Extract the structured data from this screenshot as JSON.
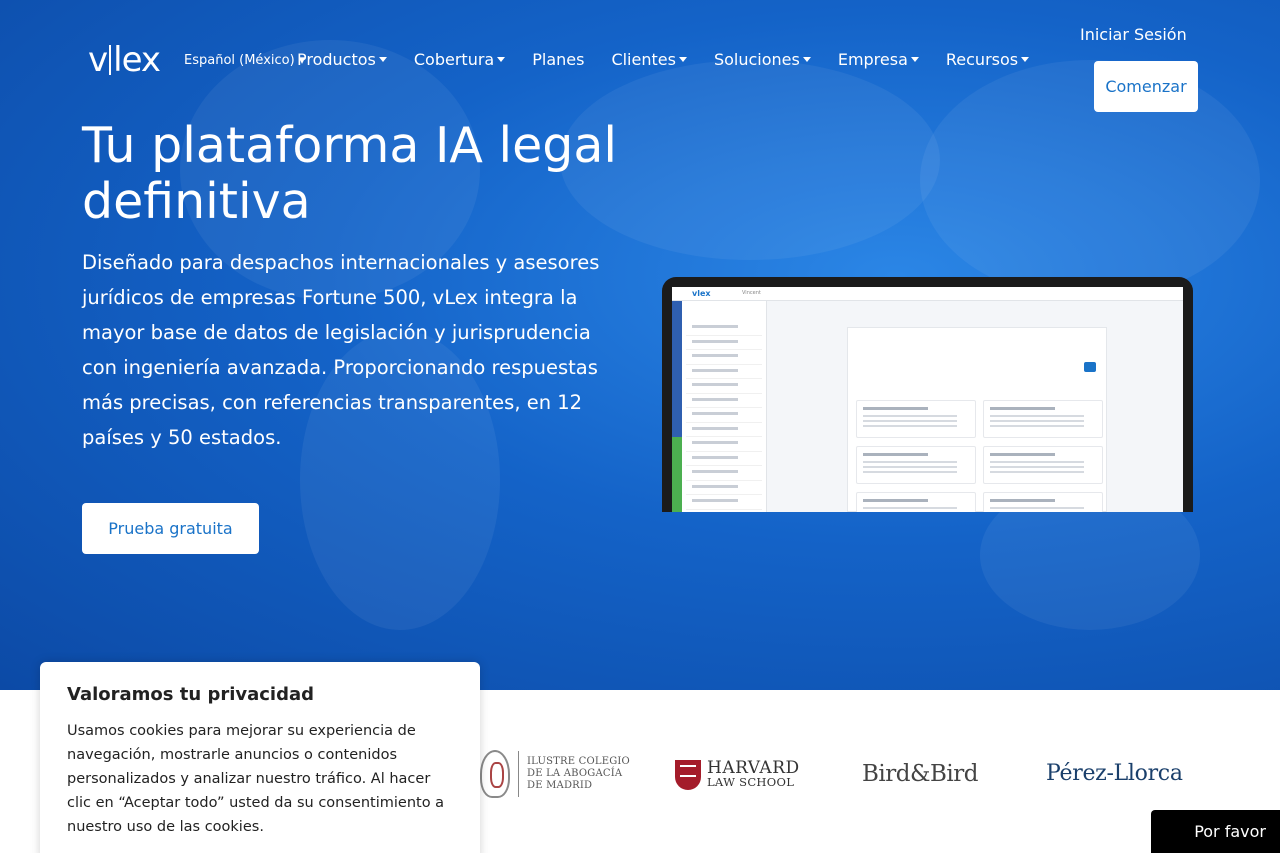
{
  "header": {
    "brand": "vlex",
    "language": "Español (México) ▾",
    "nav": [
      {
        "label": "Productos",
        "dropdown": true
      },
      {
        "label": "Cobertura",
        "dropdown": true
      },
      {
        "label": "Planes",
        "dropdown": false
      },
      {
        "label": "Clientes",
        "dropdown": true
      },
      {
        "label": "Soluciones",
        "dropdown": true
      },
      {
        "label": "Empresa",
        "dropdown": true
      },
      {
        "label": "Recursos",
        "dropdown": true
      }
    ],
    "login_label": "Iniciar Sesión",
    "start_label": "Comenzar"
  },
  "hero": {
    "title": "Tu plataforma IA legal definitiva",
    "description": "Diseñado para despachos internacionales y asesores jurídicos de empresas Fortune 500, vLex integra la mayor base de datos de legislación y jurisprudencia con ingeniería avanzada. Proporcionando respuestas más precisas, con referencias transparentes, en 12 países y 50 estados.",
    "cta_label": "Prueba gratuita",
    "screenshot_app": {
      "logo": "vlex",
      "tab": "Vincent"
    }
  },
  "privacy": {
    "title": "Valoramos tu privacidad",
    "text": "Usamos cookies para mejorar su experiencia de navegación, mostrarle anuncios o contenidos personalizados y analizar nuestro tráfico. Al hacer clic en “Aceptar todo” usted da su consentimiento a nuestro uso de las cookies."
  },
  "clients": {
    "icam": [
      "ILUSTRE COLEGIO",
      "DE LA ABOGACÍA",
      "DE MADRID"
    ],
    "harvard": [
      "HARVARD",
      "LAW SCHOOL"
    ],
    "bird": "Bird&Bird",
    "perez": "Pérez-Llorca"
  },
  "help_widget": "Por favor",
  "colors": {
    "hero_blue": "#1463c8",
    "accent": "#1a73c8"
  }
}
